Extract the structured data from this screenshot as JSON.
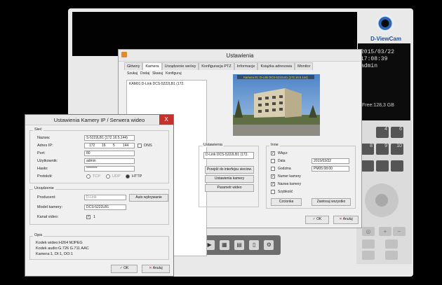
{
  "brand": {
    "name": "D-ViewCam"
  },
  "info": {
    "date": "2015/03/22",
    "time": "17:08:39",
    "user": "admin",
    "free": "Free:128,3 GB"
  },
  "toolbar_icons": [
    "record-icon",
    "timeline-icon",
    "layout-icon",
    "document-icon",
    "settings-icon"
  ],
  "settings": {
    "title": "Ustawienia",
    "tabs": [
      "Główny",
      "Kamera",
      "Urządzenie we/wy",
      "Konfiguracja PTZ",
      "Informacje",
      "Książka adresowa",
      "Monitor"
    ],
    "active_tab": "Kamera",
    "tools": [
      "Szukaj",
      "Dodaj",
      "Skasuj",
      "Konfiguruj"
    ],
    "camera_item": "KAM01 D-Link DCS-5222LB1 (172.",
    "preview_overlay": "Kamera 01: D-Link DCS-5222LB1 (172.16.5.144)",
    "ustawienia": {
      "label": "Ustawienia",
      "camera_name": "D-Link DCS-5222LB1 (172.",
      "web_button": "Przejdź do interfejsu sieciow.",
      "camera_button": "Ustawienia kamery",
      "video_button": "Parametr wideo"
    },
    "inne": {
      "label": "Inne",
      "wlacz": "Włącz",
      "data": "Data",
      "data_value": "2015/03/22",
      "godzina": "Godzina",
      "godzina_value": "PM05:08:00",
      "numer": "Numer kamery",
      "nazwa": "Nazwa kamery",
      "szybkosc": "Szybkość",
      "font_button": "Czcionka",
      "apply_button": "Zastosuj wszystko"
    },
    "ok": "OK",
    "cancel": "Anuluj"
  },
  "camdlg": {
    "title": "Ustawienia Kamery IP / Serwera wideo",
    "close": "X",
    "siec": "Sieć",
    "nazwa_label": "Nazwa:",
    "nazwa_value": "S-5222LB1 (172.16.5.144)",
    "ip_label": "Adres IP:",
    "ip": [
      "172",
      "16",
      "5",
      "144"
    ],
    "dns": "DNS",
    "port_label": "Port:",
    "port_value": "80",
    "user_label": "Użytkownik:",
    "user_value": "admin",
    "pass_label": "Hasło:",
    "pass_value": "********",
    "proto_label": "Protokół:",
    "proto_tcp": "TCP",
    "proto_udp": "UDP",
    "proto_http": "HTTP",
    "urzadzenie": "Urządzenie",
    "producent_label": "Producent:",
    "producent_value": "D-Link",
    "auto_button": "Auto wykrywanie",
    "model_label": "Model kamery:",
    "model_value": "DCS-5222LB1",
    "kanal_label": "Kanał video:",
    "kanal_value": "1",
    "opis": "Opis",
    "opis_lines": [
      "Kodek wideo:H264 MJPEG",
      "Kodek audio:G.726 G.711 AAC",
      "Kamera:1, DI:1, DO:1"
    ],
    "ok": "OK",
    "cancel": "Anuluj"
  }
}
